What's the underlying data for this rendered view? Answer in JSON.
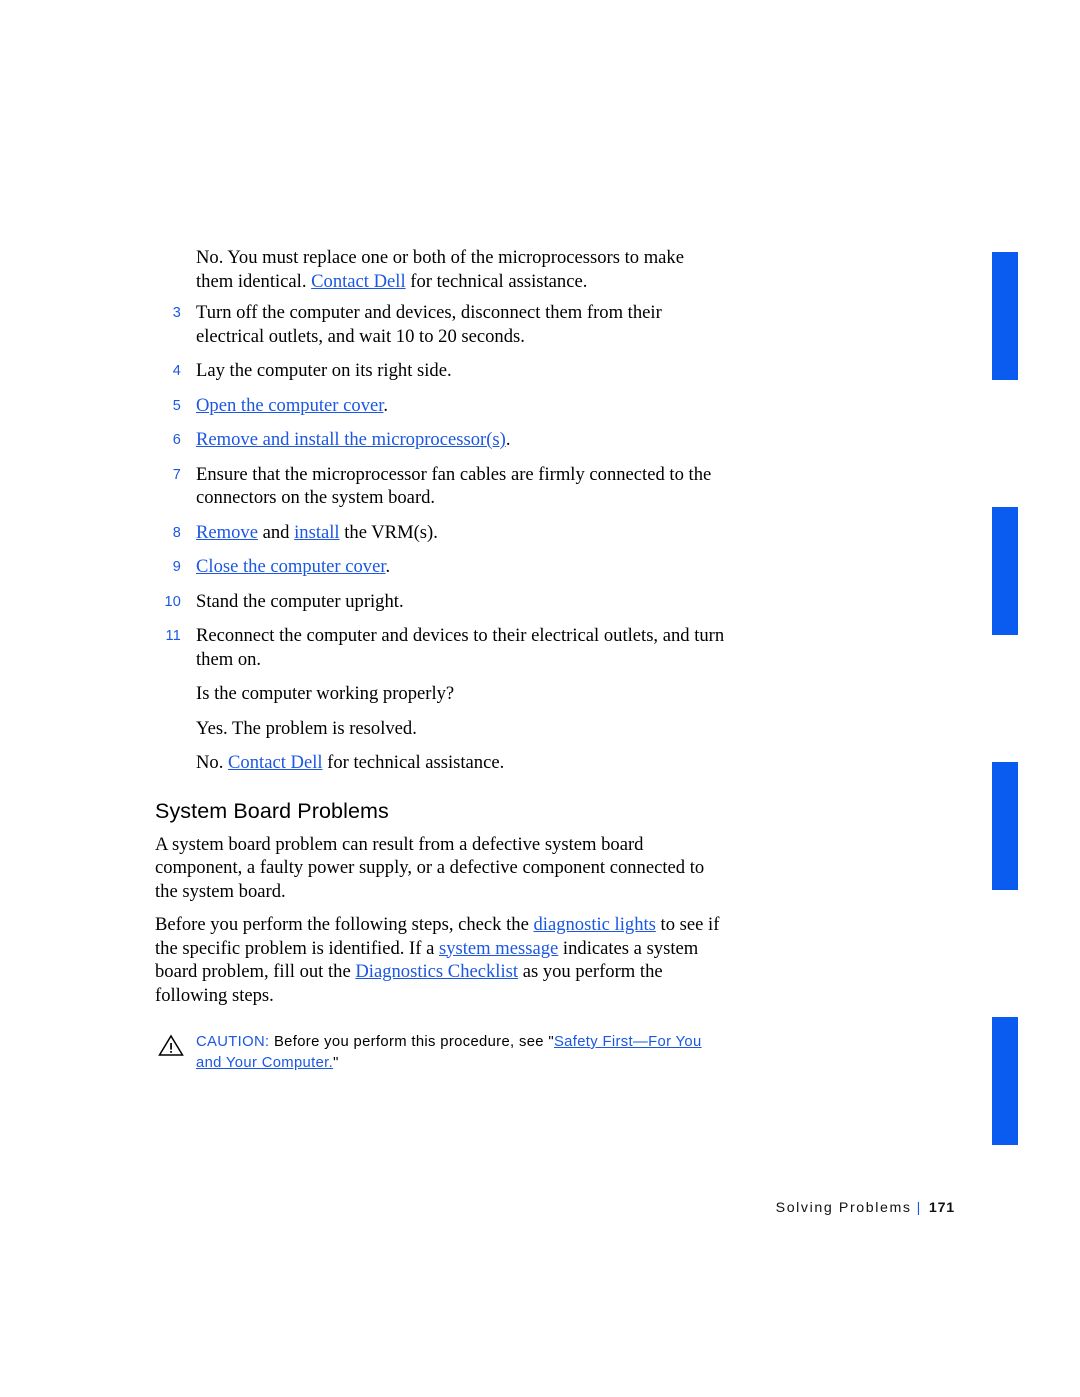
{
  "document": {
    "page_number": "171",
    "footer_section": "Solving Problems",
    "footer_separator": "|",
    "accent_color": "#0a5bf0",
    "link_color": "#1b57e3"
  },
  "continued_answer": {
    "line1_a": "No. You must replace one or both of the microprocessors to make them identical. ",
    "link": "Contact Dell",
    "line1_b": " for technical assistance."
  },
  "steps": [
    {
      "num": "3",
      "parts": [
        {
          "text": "Turn off the computer and devices, disconnect them from their electrical outlets, and wait 10 to 20 seconds.",
          "link": false
        }
      ]
    },
    {
      "num": "4",
      "parts": [
        {
          "text": "Lay the computer on its right side.",
          "link": false
        }
      ]
    },
    {
      "num": "5",
      "parts": [
        {
          "text": "Open the computer cover",
          "link": true
        },
        {
          "text": ".",
          "link": false
        }
      ]
    },
    {
      "num": "6",
      "parts": [
        {
          "text": "Remove and install the microprocessor(s)",
          "link": true
        },
        {
          "text": ".",
          "link": false
        }
      ]
    },
    {
      "num": "7",
      "parts": [
        {
          "text": "Ensure that the microprocessor fan cables are firmly connected to the connectors on the system board.",
          "link": false
        }
      ]
    },
    {
      "num": "8",
      "parts": [
        {
          "text": "Remove",
          "link": true
        },
        {
          "text": " and ",
          "link": false
        },
        {
          "text": "install",
          "link": true
        },
        {
          "text": " the VRM(s).",
          "link": false
        }
      ]
    },
    {
      "num": "9",
      "parts": [
        {
          "text": "Close the computer cover",
          "link": true
        },
        {
          "text": ".",
          "link": false
        }
      ]
    },
    {
      "num": "10",
      "parts": [
        {
          "text": "Stand the computer upright.",
          "link": false
        }
      ]
    },
    {
      "num": "11",
      "parts": [
        {
          "text": "Reconnect the computer and devices to their electrical outlets, and turn them on.",
          "link": false
        }
      ]
    }
  ],
  "after_steps": {
    "question": "Is the computer working properly?",
    "answer_yes": "Yes. The problem is resolved.",
    "answer_no_a": "No. ",
    "answer_no_link": "Contact Dell",
    "answer_no_b": " for technical assistance."
  },
  "section": {
    "heading": "System Board Problems",
    "paragraph1": "A system board problem can result from a defective system board component, a faulty power supply, or a defective component connected to the system board.",
    "paragraph2": {
      "a": "Before you perform the following steps, check the ",
      "link1": "diagnostic lights",
      "b": " to see if the specific problem is identified. If a ",
      "link2": "system message",
      "c": " indicates a system board problem, fill out the ",
      "link3": "Diagnostics Checklist",
      "d": " as you perform the following steps."
    }
  },
  "caution": {
    "icon": "warning-triangle-icon",
    "label": "CAUTION:",
    "body": " Before you perform this procedure, see \"",
    "link": "Safety First—For You and Your Computer.",
    "close_quote": "\""
  }
}
